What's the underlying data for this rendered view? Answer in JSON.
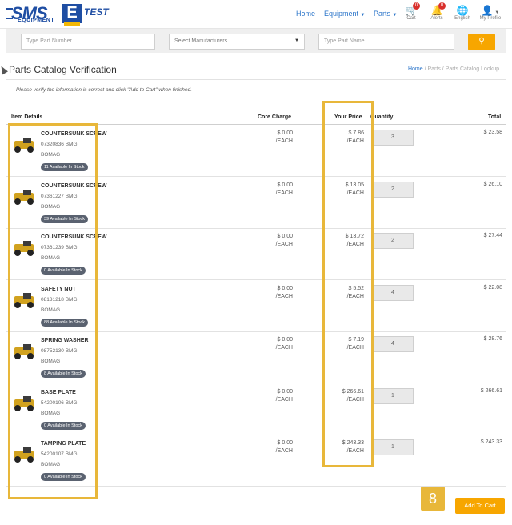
{
  "header": {
    "logo": {
      "sms": "SMS",
      "equipment": "EQUIPMENT",
      "e": "E",
      "test": "TEST"
    },
    "nav": {
      "home": "Home",
      "equipment": "Equipment",
      "parts": "Parts"
    },
    "icons": [
      {
        "name": "cart-icon",
        "label": "Cart",
        "badge": "0"
      },
      {
        "name": "alerts-icon",
        "label": "Alerts",
        "badge": "0"
      },
      {
        "name": "globe-icon",
        "label": "English"
      },
      {
        "name": "user-icon",
        "label": "My Profile"
      }
    ]
  },
  "search": {
    "part_number_placeholder": "Type Part Number",
    "manufacturer_placeholder": "Select Manufacturers",
    "part_name_placeholder": "Type Part Name"
  },
  "page": {
    "title": "Parts Catalog Verification",
    "breadcrumb": {
      "home": "Home",
      "sep1": " / ",
      "parts": "Parts",
      "sep2": " / ",
      "current": "Parts Catalog Lookup"
    },
    "instruction": "Please verify the information is correct and click \"Add to Cart\" when finished."
  },
  "table": {
    "headers": {
      "item": "Item Details",
      "core": "Core Charge",
      "price": "Your Price",
      "qty": "Quantity",
      "total": "Total"
    },
    "rows": [
      {
        "name": "COUNTERSUNK SCREW",
        "number": "07320836 BMG",
        "manufacturer": "BOMAG",
        "stock": "11 Available In Stock",
        "core": "$ 0.00",
        "core_unit": "/EACH",
        "price": "$ 7.86",
        "price_unit": "/EACH",
        "qty": "3",
        "total": "$ 23.58"
      },
      {
        "name": "COUNTERSUNK SCREW",
        "number": "07361227 BMG",
        "manufacturer": "BOMAG",
        "stock": "39 Available In Stock",
        "core": "$ 0.00",
        "core_unit": "/EACH",
        "price": "$ 13.05",
        "price_unit": "/EACH",
        "qty": "2",
        "total": "$ 26.10"
      },
      {
        "name": "COUNTERSUNK SCREW",
        "number": "07361239 BMG",
        "manufacturer": "BOMAG",
        "stock": "0 Available In Stock",
        "core": "$ 0.00",
        "core_unit": "/EACH",
        "price": "$ 13.72",
        "price_unit": "/EACH",
        "qty": "2",
        "total": "$ 27.44"
      },
      {
        "name": "SAFETY NUT",
        "number": "08131218 BMG",
        "manufacturer": "BOMAG",
        "stock": "88 Available In Stock",
        "core": "$ 0.00",
        "core_unit": "/EACH",
        "price": "$ 5.52",
        "price_unit": "/EACH",
        "qty": "4",
        "total": "$ 22.08"
      },
      {
        "name": "SPRING WASHER",
        "number": "08752130 BMG",
        "manufacturer": "BOMAG",
        "stock": "8 Available In Stock",
        "core": "$ 0.00",
        "core_unit": "/EACH",
        "price": "$ 7.19",
        "price_unit": "/EACH",
        "qty": "4",
        "total": "$ 28.76"
      },
      {
        "name": "BASE PLATE",
        "number": "54200106 BMG",
        "manufacturer": "BOMAG",
        "stock": "0 Available In Stock",
        "core": "$ 0.00",
        "core_unit": "/EACH",
        "price": "$ 266.61",
        "price_unit": "/EACH",
        "qty": "1",
        "total": "$ 266.61"
      },
      {
        "name": "TAMPING PLATE",
        "number": "54200107 BMG",
        "manufacturer": "BOMAG",
        "stock": "0 Available In Stock",
        "core": "$ 0.00",
        "core_unit": "/EACH",
        "price": "$ 243.33",
        "price_unit": "/EACH",
        "qty": "1",
        "total": "$ 243.33"
      }
    ]
  },
  "footer": {
    "step": "8",
    "add_to_cart": "Add To Cart"
  },
  "colors": {
    "accent": "#f7a600",
    "highlight": "#e8b73a",
    "link": "#2a74c9",
    "brand": "#1f4ea3"
  }
}
